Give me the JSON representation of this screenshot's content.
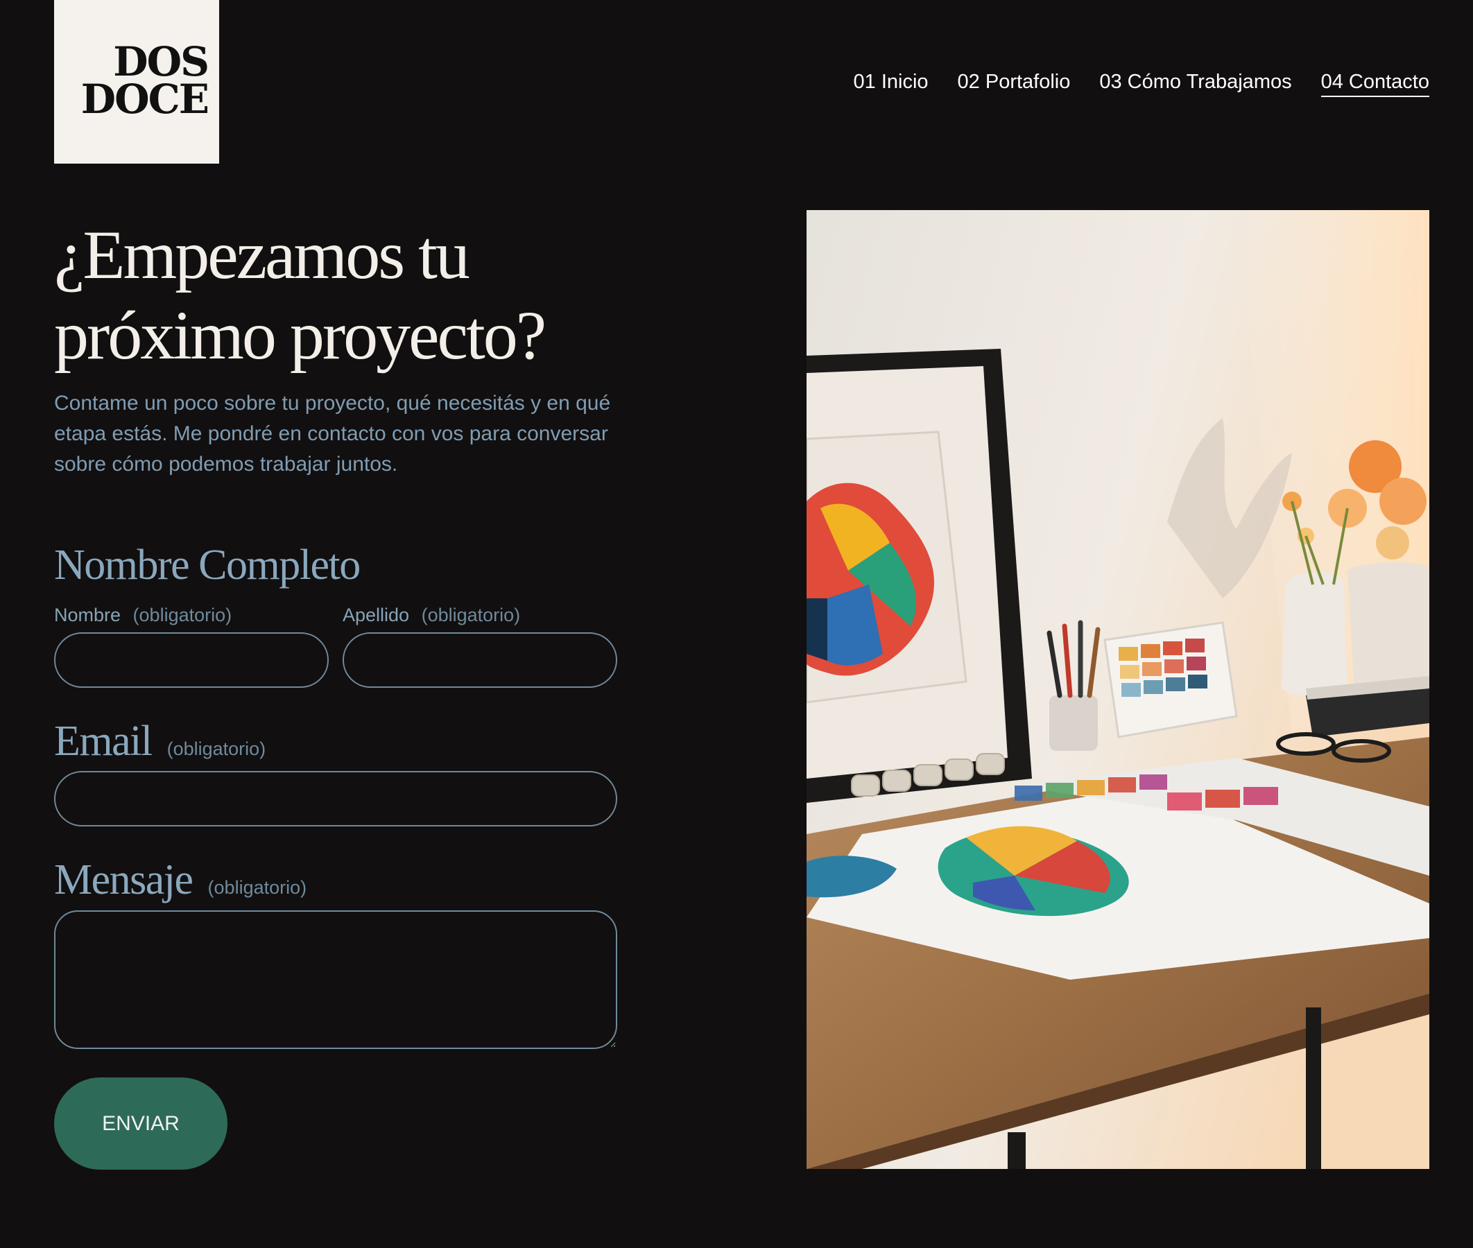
{
  "logo": {
    "line1": "DOS",
    "line2": "DOCE"
  },
  "nav": [
    {
      "label": "01 Inicio",
      "active": false
    },
    {
      "label": "02 Portafolio",
      "active": false
    },
    {
      "label": "03 Cómo Trabajamos",
      "active": false
    },
    {
      "label": "04 Contacto",
      "active": true
    }
  ],
  "hero": {
    "title": "¿Empezamos tu próximo proyecto?",
    "intro": "Contame un poco sobre tu proyecto, qué necesitás y en qué etapa estás. Me pondré en contacto con vos para conversar sobre cómo podemos trabajar juntos."
  },
  "form": {
    "name_section": {
      "title": "Nombre Completo",
      "first_name_label": "Nombre",
      "last_name_label": "Apellido",
      "required": "(obligatorio)",
      "first_name_value": "",
      "last_name_value": ""
    },
    "email_section": {
      "title": "Email",
      "required": "(obligatorio)",
      "value": ""
    },
    "message_section": {
      "title": "Mensaje",
      "required": "(obligatorio)",
      "value": ""
    },
    "submit_label": "ENVIAR"
  },
  "colors": {
    "background": "#120f10",
    "accent_label": "#8aa8bd",
    "button": "#2e6a58",
    "logo_bg": "#f5f2ee"
  }
}
